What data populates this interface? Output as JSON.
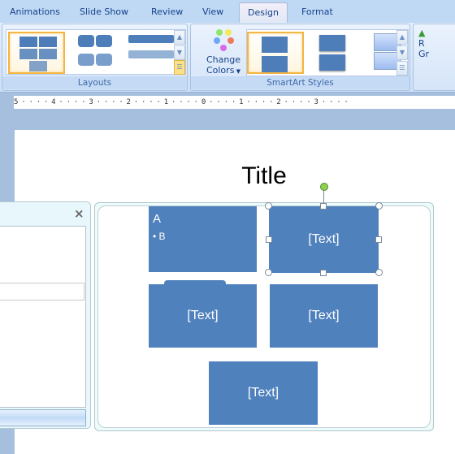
{
  "tabs": [
    {
      "label": "Animations"
    },
    {
      "label": "Slide Show"
    },
    {
      "label": "Review"
    },
    {
      "label": "View"
    },
    {
      "label": "Design",
      "active": true
    },
    {
      "label": "Format"
    }
  ],
  "ribbon": {
    "layouts": {
      "label": "Layouts"
    },
    "change_colors": {
      "line1": "Change",
      "line2": "Colors"
    },
    "smartart_styles": {
      "label": "SmartArt Styles"
    },
    "reset_graphic": {
      "line1": "R",
      "line2": "Gr"
    }
  },
  "ruler": {
    "text": "5 · · · · 4 · · · · 3 · · · · 2 · · · · 1 · · · · 0 · · · · 1 · · · · 2 · · · · 3 · · · ·"
  },
  "slide": {
    "title": "Title",
    "shapes": [
      {
        "heading": "A",
        "bullet": "B"
      },
      {
        "text": "[Text]"
      },
      {
        "text": "[Text]"
      },
      {
        "text": "[Text]"
      },
      {
        "text": "[Text]"
      }
    ]
  },
  "text_pane": {
    "close": "×"
  },
  "colors": {
    "accent": "#4f81bd",
    "ribbon": "#d6e6f7",
    "selection": "#f3b543"
  }
}
